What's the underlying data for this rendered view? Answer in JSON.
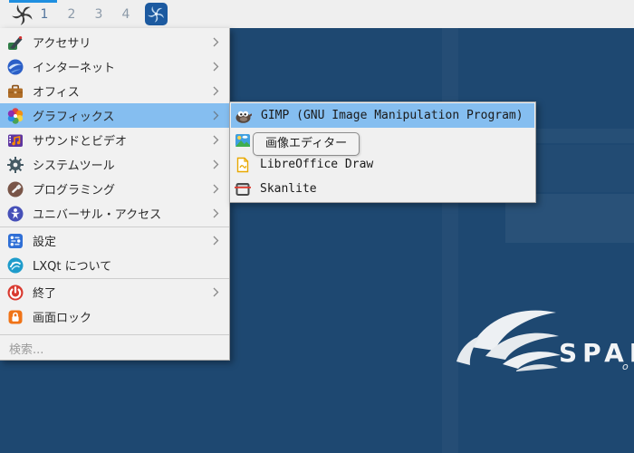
{
  "panel": {
    "menu_button_icon": "sparky-swirl",
    "workspaces": [
      "1",
      "2",
      "3",
      "4"
    ],
    "active_workspace": "1",
    "task_icon": "sparky-app"
  },
  "menu": {
    "items": [
      {
        "label": "アクセサリ",
        "has_submenu": true
      },
      {
        "label": "インターネット",
        "has_submenu": true
      },
      {
        "label": "オフィス",
        "has_submenu": true
      },
      {
        "label": "グラフィックス",
        "has_submenu": true,
        "highlighted": true
      },
      {
        "label": "サウンドとビデオ",
        "has_submenu": true
      },
      {
        "label": "システムツール",
        "has_submenu": true
      },
      {
        "label": "プログラミング",
        "has_submenu": true
      },
      {
        "label": "ユニバーサル・アクセス",
        "has_submenu": true
      },
      {
        "label": "設定",
        "has_submenu": true
      },
      {
        "label": "LXQt について",
        "has_submenu": false
      },
      {
        "label": "終了",
        "has_submenu": true
      },
      {
        "label": "画面ロック",
        "has_submenu": false
      }
    ],
    "search_label": "検索..."
  },
  "submenu": {
    "items": [
      {
        "label": "GIMP (GNU Image Manipulation Program)",
        "highlighted": true
      },
      {
        "label": ""
      },
      {
        "label": "LibreOffice Draw"
      },
      {
        "label": "Skanlite"
      }
    ]
  },
  "tooltip": {
    "text": "画像エディター"
  },
  "desktop": {
    "brand_text": "SPAR",
    "brand_tagline_fragment": "o"
  },
  "colors": {
    "highlight": "#85bef0",
    "panel_bg": "#efefef",
    "desktop_bg": "#1e4871",
    "menu_bg": "#f1f1f1",
    "accent_bar": "#1f8fe0"
  }
}
